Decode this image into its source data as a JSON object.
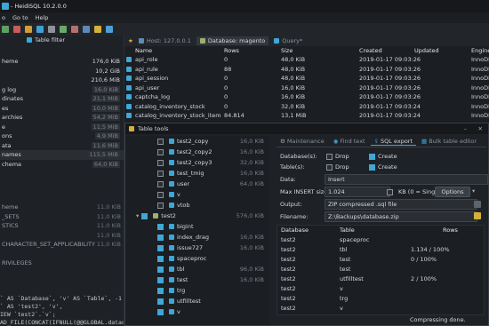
{
  "window": {
    "title": "- HeidiSQL 10.2.0.0"
  },
  "menu": [
    "o",
    "Go to",
    "Help"
  ],
  "left": {
    "table_filter_label": "Table filter",
    "db_items": [
      {
        "name": "heme",
        "size": "176,0 KiB"
      },
      {
        "name": "",
        "size": "10,2 GiB"
      },
      {
        "name": "",
        "size": "210,6 MiB"
      },
      {
        "name": "g log",
        "size": "16,0 KiB"
      },
      {
        "name": "dinates",
        "size": "21,1 MiB"
      },
      {
        "name": "es",
        "size": "10,0 MiB"
      },
      {
        "name": "archies",
        "size": "54,2 MiB"
      },
      {
        "name": "e",
        "size": "11,5 MiB"
      },
      {
        "name": "ons",
        "size": "4,9 MiB"
      },
      {
        "name": "ata",
        "size": "11,6 MiB"
      },
      {
        "name": "names",
        "size": "115,5 MiB"
      },
      {
        "name": "chema",
        "size": "64,0 KiB"
      }
    ],
    "lower_items": [
      {
        "name": "heme",
        "size": "11,0 KiB"
      },
      {
        "name": "_SETS",
        "size": "11,0 KiB"
      },
      {
        "name": "STICS",
        "size": "11,0 KiB"
      },
      {
        "name": "",
        "size": "11,0 KiB"
      },
      {
        "name": "CHARACTER_SET_APPLICABILITY",
        "size": "11,0 KiB"
      },
      {
        "name": "",
        "size": ""
      },
      {
        "name": "RIVILEGES",
        "size": ""
      }
    ],
    "sql_lines": [
      "` AS `Database`, 'v' AS `Table`, -1 AS",
      "` AS 'test2', 'v',",
      "IEW `test2`.`v`;",
      "AD_FILE(CONCAT(IFNULL(@@GLOBAL.datadir,"
    ]
  },
  "topbar": {
    "host_tab": "Host: 127.0.0.1",
    "db_tab": "Database: magento",
    "query_tab": "Query*"
  },
  "grid": {
    "headers": [
      "Name",
      "Rows",
      "Size",
      "Created",
      "Updated",
      "Engine"
    ],
    "rows": [
      [
        "api_role",
        "0",
        "48,0 KiB",
        "2019-01-17 09:03:26",
        "",
        "InnoDB"
      ],
      [
        "api_rule",
        "88",
        "48,0 KiB",
        "2019-01-17 09:03:26",
        "",
        "InnoDB"
      ],
      [
        "api_session",
        "0",
        "48,0 KiB",
        "2019-01-17 09:03:26",
        "",
        "InnoDB"
      ],
      [
        "api_user",
        "0",
        "16,0 KiB",
        "2019-01-17 09:03:26",
        "",
        "InnoDB"
      ],
      [
        "captcha_log",
        "0",
        "16,0 KiB",
        "2019-01-17 09:03:26",
        "",
        "InnoDB"
      ],
      [
        "catalog_inventory_stock",
        "0",
        "32,0 KiB",
        "2019-01-17 09:03:24",
        "",
        "InnoDB"
      ],
      [
        "catalog_inventory_stock_item",
        "84.814",
        "13,1 MiB",
        "2019-01-17 09:03:24",
        "",
        "InnoDB"
      ]
    ]
  },
  "dialog": {
    "title": "Table tools",
    "tree": [
      {
        "name": "test2_copy",
        "size": "16,0 KiB",
        "checked": false,
        "indent": 3
      },
      {
        "name": "test2_copy2",
        "size": "16,0 KiB",
        "checked": false,
        "indent": 3
      },
      {
        "name": "test2_copy3",
        "size": "32,0 KiB",
        "checked": false,
        "indent": 3
      },
      {
        "name": "test_tmig",
        "size": "16,0 KiB",
        "checked": false,
        "indent": 3
      },
      {
        "name": "user",
        "size": "64,0 KiB",
        "checked": false,
        "indent": 3
      },
      {
        "name": "v",
        "size": "",
        "checked": false,
        "indent": 3
      },
      {
        "name": "vtob",
        "size": "",
        "checked": false,
        "indent": 3
      },
      {
        "name": "test2",
        "size": "576,0 KiB",
        "checked": true,
        "indent": 1
      },
      {
        "name": "bigint",
        "size": "",
        "checked": true,
        "indent": 3
      },
      {
        "name": "index_drag",
        "size": "16,0 KiB",
        "checked": true,
        "indent": 3
      },
      {
        "name": "issue727",
        "size": "16,0 KiB",
        "checked": true,
        "indent": 3
      },
      {
        "name": "spaceproc",
        "size": "",
        "checked": true,
        "indent": 3
      },
      {
        "name": "tbl",
        "size": "96,0 KiB",
        "checked": true,
        "indent": 3
      },
      {
        "name": "test",
        "size": "16,0 KiB",
        "checked": true,
        "indent": 3
      },
      {
        "name": "trg",
        "size": "",
        "checked": true,
        "indent": 3
      },
      {
        "name": "utfilltest",
        "size": "",
        "checked": true,
        "indent": 3
      },
      {
        "name": "v",
        "size": "",
        "checked": true,
        "indent": 3
      }
    ],
    "tabs": [
      "Maintenance",
      "Find text",
      "SQL export",
      "Bulk table editor"
    ],
    "active_tab": 2,
    "form": {
      "databases_label": "Database(s):",
      "tables_label": "Table(s):",
      "drop": "Drop",
      "create": "Create",
      "data_label": "Data:",
      "data_value": "Insert",
      "max_insert_label": "Max INSERT size:",
      "max_insert_value": "1.024",
      "max_insert_unit": "KB (0 = Single",
      "options_btn": "Options",
      "output_label": "Output:",
      "output_value": "ZIP compressed .sql file",
      "filename_label": "Filename:",
      "filename_value": "Z:\\Backups\\database.zip"
    },
    "results_headers": [
      "Database",
      "Table",
      "Rows"
    ],
    "results": [
      [
        "test2",
        "spaceproc",
        ""
      ],
      [
        "test2",
        "tbl",
        "1.134 / 100%"
      ],
      [
        "test2",
        "test",
        "0 / 100%"
      ],
      [
        "test2",
        "test",
        ""
      ],
      [
        "test2",
        "utfilltest",
        "2 / 100%"
      ],
      [
        "test2",
        "v",
        ""
      ],
      [
        "test2",
        "trg",
        ""
      ],
      [
        "test2",
        "v",
        ""
      ]
    ],
    "status": "Compressing done."
  },
  "colors": {
    "accent": "#3fa7d6",
    "selection": "#2f5d8d",
    "panel": "#1e2126"
  }
}
